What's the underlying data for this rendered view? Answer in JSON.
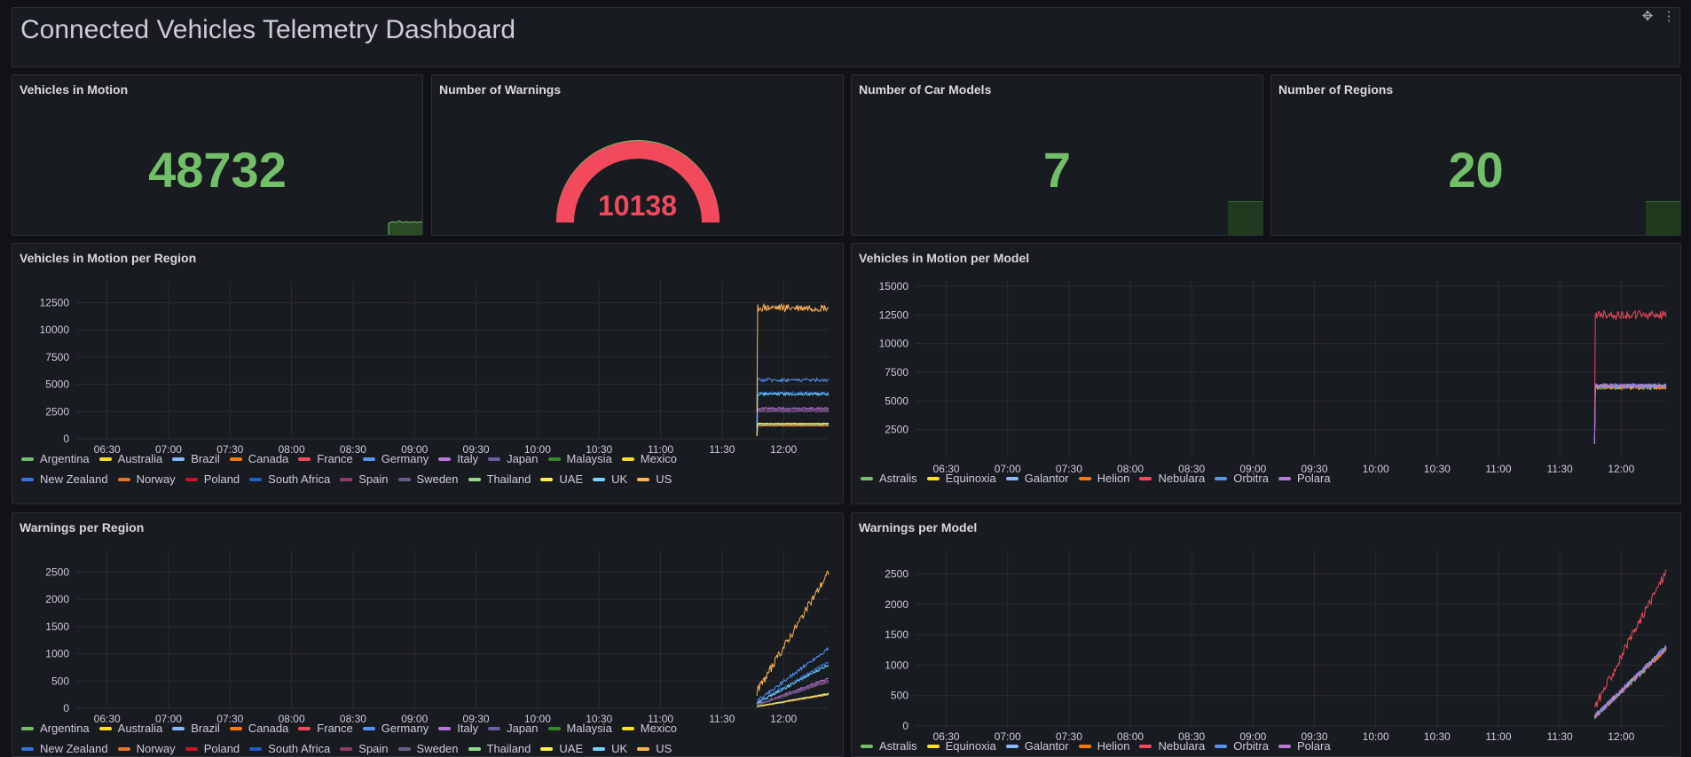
{
  "dashboard": {
    "title": "Connected Vehicles Telemetry Dashboard",
    "move_icon": "move-icon",
    "menu_icon": "kebab-menu-icon"
  },
  "stats": {
    "vehicles_in_motion": {
      "title": "Vehicles in Motion",
      "value": "48732"
    },
    "warnings": {
      "title": "Number of Warnings",
      "value": "10138",
      "gauge_fraction": 1.0
    },
    "car_models": {
      "title": "Number of Car Models",
      "value": "7"
    },
    "regions": {
      "title": "Number of Regions",
      "value": "20"
    }
  },
  "colors": {
    "green": "#73bf69",
    "red": "#f2495c"
  },
  "chart_data": [
    {
      "type": "line",
      "title": "Vehicles in Motion per Region",
      "x_ticks": [
        "06:30",
        "07:00",
        "07:30",
        "08:00",
        "08:30",
        "09:00",
        "09:30",
        "10:00",
        "10:30",
        "11:00",
        "11:30",
        "12:00"
      ],
      "y_ticks": [
        "0",
        "2500",
        "5000",
        "7500",
        "10000",
        "12500"
      ],
      "ylim": [
        0,
        14000
      ],
      "grid": true,
      "legend_placement": "bottom",
      "data_starts_at": "11:47",
      "series": [
        {
          "name": "Argentina",
          "color": "#73bf69",
          "value": 1200
        },
        {
          "name": "Australia",
          "color": "#fade2a",
          "value": 1300
        },
        {
          "name": "Brazil",
          "color": "#8ab8ff",
          "value": 1400
        },
        {
          "name": "Canada",
          "color": "#ff780a",
          "value": 1200
        },
        {
          "name": "France",
          "color": "#f2495c",
          "value": 1300
        },
        {
          "name": "Germany",
          "color": "#5794f2",
          "value": 5400
        },
        {
          "name": "Italy",
          "color": "#b877d9",
          "value": 2800
        },
        {
          "name": "Japan",
          "color": "#705da0",
          "value": 2700
        },
        {
          "name": "Malaysia",
          "color": "#37872d",
          "value": 1300
        },
        {
          "name": "Mexico",
          "color": "#fade2a",
          "value": 1300
        },
        {
          "name": "New Zealand",
          "color": "#3274d9",
          "value": 4200
        },
        {
          "name": "Norway",
          "color": "#e0752d",
          "value": 1200
        },
        {
          "name": "Poland",
          "color": "#c4162a",
          "value": 1300
        },
        {
          "name": "South Africa",
          "color": "#1f60c4",
          "value": 1400
        },
        {
          "name": "Spain",
          "color": "#8f3b6b",
          "value": 2600
        },
        {
          "name": "Sweden",
          "color": "#6c5a8a",
          "value": 2500
        },
        {
          "name": "Thailand",
          "color": "#96d98d",
          "value": 1300
        },
        {
          "name": "UAE",
          "color": "#ffee52",
          "value": 1400
        },
        {
          "name": "UK",
          "color": "#73d4ff",
          "value": 4100
        },
        {
          "name": "US",
          "color": "#ffb357",
          "value": 12000
        }
      ]
    },
    {
      "type": "line",
      "title": "Vehicles in Motion per Model",
      "x_ticks": [
        "06:30",
        "07:00",
        "07:30",
        "08:00",
        "08:30",
        "09:00",
        "09:30",
        "10:00",
        "10:30",
        "11:00",
        "11:30",
        "12:00"
      ],
      "y_ticks": [
        "2500",
        "5000",
        "7500",
        "10000",
        "12500",
        "15000"
      ],
      "ylim": [
        0,
        15000
      ],
      "grid": true,
      "legend_placement": "bottom",
      "data_starts_at": "11:47",
      "series": [
        {
          "name": "Astralis",
          "color": "#73bf69",
          "value": 6200
        },
        {
          "name": "Equinoxia",
          "color": "#fade2a",
          "value": 6200
        },
        {
          "name": "Galantor",
          "color": "#8ab8ff",
          "value": 6300
        },
        {
          "name": "Helion",
          "color": "#ff780a",
          "value": 6200
        },
        {
          "name": "Nebulara",
          "color": "#f2495c",
          "value": 12500
        },
        {
          "name": "Orbitra",
          "color": "#5794f2",
          "value": 6300
        },
        {
          "name": "Polara",
          "color": "#b877d9",
          "value": 6300
        }
      ]
    },
    {
      "type": "line",
      "title": "Warnings per Region",
      "x_ticks": [
        "06:30",
        "07:00",
        "07:30",
        "08:00",
        "08:30",
        "09:00",
        "09:30",
        "10:00",
        "10:30",
        "11:00",
        "11:30",
        "12:00"
      ],
      "y_ticks": [
        "0",
        "500",
        "1000",
        "1500",
        "2000",
        "2500"
      ],
      "ylim": [
        0,
        2800
      ],
      "grid": true,
      "legend_placement": "bottom",
      "data_starts_at": "11:47",
      "series": [
        {
          "name": "Argentina",
          "color": "#73bf69",
          "value": 250
        },
        {
          "name": "Australia",
          "color": "#fade2a",
          "value": 260
        },
        {
          "name": "Brazil",
          "color": "#8ab8ff",
          "value": 270
        },
        {
          "name": "Canada",
          "color": "#ff780a",
          "value": 250
        },
        {
          "name": "France",
          "color": "#f2495c",
          "value": 260
        },
        {
          "name": "Germany",
          "color": "#5794f2",
          "value": 1100
        },
        {
          "name": "Italy",
          "color": "#b877d9",
          "value": 550
        },
        {
          "name": "Japan",
          "color": "#705da0",
          "value": 520
        },
        {
          "name": "Malaysia",
          "color": "#37872d",
          "value": 260
        },
        {
          "name": "Mexico",
          "color": "#fade2a",
          "value": 250
        },
        {
          "name": "New Zealand",
          "color": "#3274d9",
          "value": 850
        },
        {
          "name": "Norway",
          "color": "#e0752d",
          "value": 250
        },
        {
          "name": "Poland",
          "color": "#c4162a",
          "value": 260
        },
        {
          "name": "South Africa",
          "color": "#1f60c4",
          "value": 270
        },
        {
          "name": "Spain",
          "color": "#8f3b6b",
          "value": 500
        },
        {
          "name": "Sweden",
          "color": "#6c5a8a",
          "value": 480
        },
        {
          "name": "Thailand",
          "color": "#96d98d",
          "value": 260
        },
        {
          "name": "UAE",
          "color": "#ffee52",
          "value": 270
        },
        {
          "name": "UK",
          "color": "#73d4ff",
          "value": 800
        },
        {
          "name": "US",
          "color": "#ffb357",
          "value": 2500
        }
      ]
    },
    {
      "type": "line",
      "title": "Warnings per Model",
      "x_ticks": [
        "06:30",
        "07:00",
        "07:30",
        "08:00",
        "08:30",
        "09:00",
        "09:30",
        "10:00",
        "10:30",
        "11:00",
        "11:30",
        "12:00"
      ],
      "y_ticks": [
        "0",
        "500",
        "1000",
        "1500",
        "2000",
        "2500"
      ],
      "ylim": [
        0,
        2800
      ],
      "grid": true,
      "legend_placement": "bottom",
      "data_starts_at": "11:47",
      "series": [
        {
          "name": "Astralis",
          "color": "#73bf69",
          "value": 1250
        },
        {
          "name": "Equinoxia",
          "color": "#fade2a",
          "value": 1280
        },
        {
          "name": "Galantor",
          "color": "#8ab8ff",
          "value": 1300
        },
        {
          "name": "Helion",
          "color": "#ff780a",
          "value": 1260
        },
        {
          "name": "Nebulara",
          "color": "#f2495c",
          "value": 2550
        },
        {
          "name": "Orbitra",
          "color": "#5794f2",
          "value": 1300
        },
        {
          "name": "Polara",
          "color": "#b877d9",
          "value": 1280
        }
      ]
    }
  ]
}
